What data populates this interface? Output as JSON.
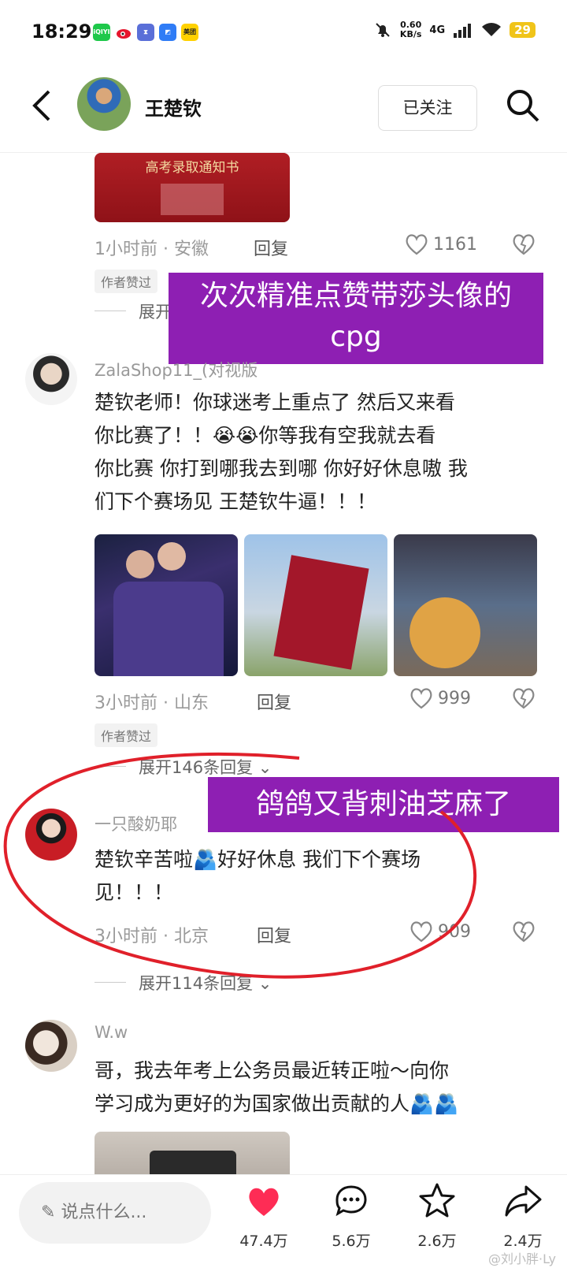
{
  "status_bar": {
    "time": "18:29",
    "net_speed_value": "0.60",
    "net_speed_unit": "KB/s",
    "network": "4G",
    "battery": "29",
    "apps": [
      "iqiyi",
      "weibo",
      "hourglass",
      "app",
      "美团"
    ]
  },
  "header": {
    "name": "王楚钦",
    "follow_label": "已关注"
  },
  "comments": [
    {
      "photo_caption": "高考录取通知书",
      "time_location": "1小时前 · 安徽",
      "reply": "回复",
      "likes": "1161",
      "author_liked": "作者赞过",
      "expand": "展开"
    },
    {
      "username": "ZalaShop11_",
      "username_suffix": "(对视版",
      "text_line1": "楚钦老师！你球迷考上重点了 然后又来看",
      "text_line2": "你比赛了！！😭😭你等我有空我就去看",
      "text_line3": "你比赛 你打到哪我去到哪 你好好休息嗷 我",
      "text_line4": "们下个赛场见 王楚钦牛逼！！！",
      "time_location": "3小时前 · 山东",
      "reply": "回复",
      "likes": "999",
      "author_liked": "作者赞过",
      "expand": "展开146条回复"
    },
    {
      "username": "一只酸奶耶",
      "text_line1": "楚钦辛苦啦🫂好好休息 我们下个赛场",
      "text_line2": "见！！！",
      "time_location": "3小时前 · 北京",
      "reply": "回复",
      "likes": "909",
      "expand": "展开114条回复"
    },
    {
      "username": "W.w",
      "text_line1": "哥，我去年考上公务员最近转正啦～向你",
      "text_line2": "学习成为更好的为国家做出贡献的人🫂🫂"
    }
  ],
  "overlays": {
    "overlay1_line1": "次次精准点赞带莎头像的",
    "overlay1_line2": "cpg",
    "overlay2": "鸽鸽又背刺油芝麻了"
  },
  "bottom_bar": {
    "input_placeholder": "说点什么...",
    "likes": "47.4万",
    "comments": "5.6万",
    "favorites": "2.6万",
    "shares": "2.4万",
    "watermark": "@刘小胖·Ly"
  },
  "colors": {
    "overlay_bg": "#8e1fb3",
    "like_red": "#fe2c55",
    "circle_red": "#e0202a"
  }
}
